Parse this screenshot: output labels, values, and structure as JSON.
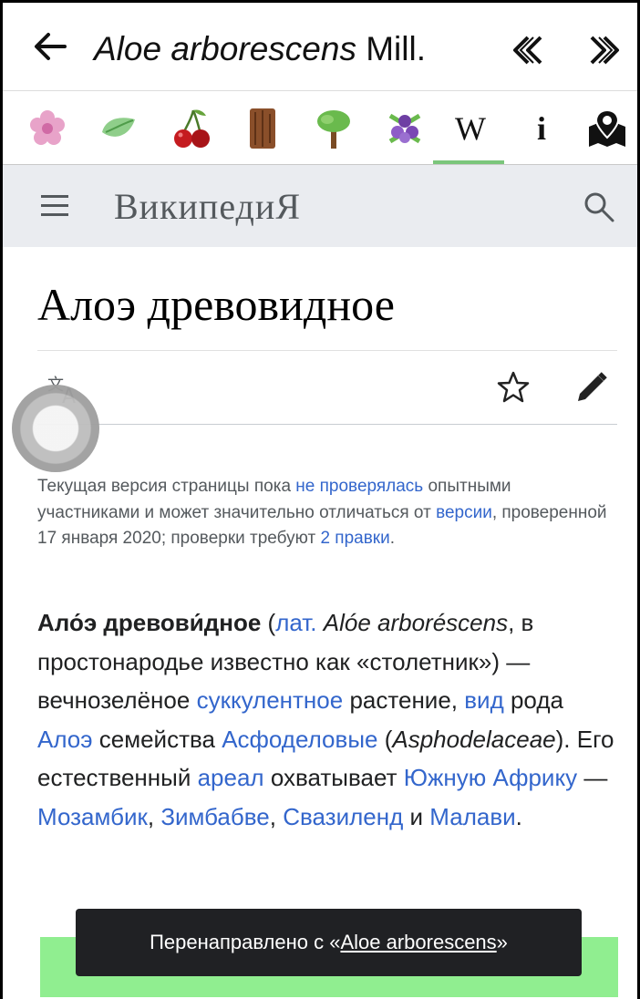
{
  "appbar": {
    "title_italic": "Aloe arborescens",
    "title_author": "Mill.",
    "back_icon": "arrow-left-icon",
    "prev_icon": "double-chevron-left-icon",
    "next_icon": "double-chevron-right-icon"
  },
  "tabs": [
    {
      "icon": "flower-icon"
    },
    {
      "icon": "leaf-icon"
    },
    {
      "icon": "cherry-fruit-icon"
    },
    {
      "icon": "bark-icon"
    },
    {
      "icon": "tree-icon"
    },
    {
      "icon": "flower-cluster-icon"
    },
    {
      "icon": "wikipedia-icon",
      "label": "W",
      "active": true
    },
    {
      "icon": "info-icon",
      "label": "i"
    },
    {
      "icon": "map-pin-icon"
    }
  ],
  "active_tab_color": "#7bc67b",
  "wiki_header": {
    "wordmark": "ВикипедиЯ",
    "background": "#eaecf0"
  },
  "article": {
    "title": "Алоэ древовидное",
    "notice": {
      "p1": "Текущая версия страницы пока ",
      "l1": "не проверялась",
      "p2": " опытными участниками и может значительно отличаться от ",
      "l2": "версии",
      "p3": ", проверенной 17 января 2020; проверки требуют ",
      "l3": "2 правки",
      "p4": "."
    },
    "lead": {
      "b1": "Ало́э древови́дное",
      "t1": " (",
      "l_lat": "лат.",
      "i1": " Alóe arboréscens",
      "t2": ", в простонародье известно как «столетник») — вечнозелёное ",
      "l_succ": "суккулентное",
      "t3": " растение, ",
      "l_vid": "вид",
      "t4": " рода ",
      "l_aloe": "Алоэ",
      "t5": " семейства ",
      "l_asph": "Асфоделовые",
      "t6": " (",
      "i2": "Asphodelaceae",
      "t7": "). Его естественный ",
      "l_areal": "ареал",
      "t8": " охватывает ",
      "l_safr": "Южную Африку",
      "t9": " — ",
      "l_moz": "Мозамбик",
      "t10": ", ",
      "l_zim": "Зимбабве",
      "t11": ", ",
      "l_swa": "Свазиленд",
      "t12": " и ",
      "l_mal": "Малави",
      "t13": "."
    },
    "link_color": "#3366cc",
    "infobox_color": "#90ee90"
  },
  "toast": {
    "prefix": "Перенаправлено с «",
    "link": "Aloe arborescens",
    "suffix": "»"
  }
}
